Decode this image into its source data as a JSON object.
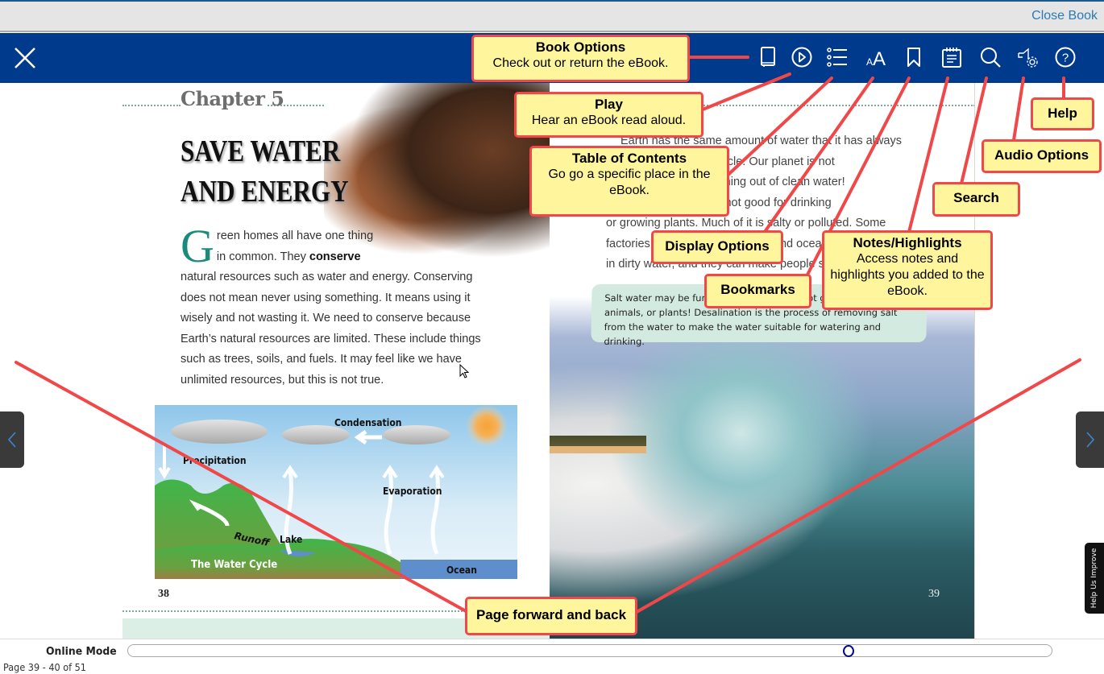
{
  "topbar": {
    "close_book_label": "Close Book"
  },
  "toolbar": {
    "close_icon": "close-icon",
    "tools": [
      {
        "name": "book-options",
        "icon": "book-icon"
      },
      {
        "name": "play",
        "icon": "play-icon"
      },
      {
        "name": "table-of-contents",
        "icon": "list-icon"
      },
      {
        "name": "display-options",
        "icon": "font-size-icon"
      },
      {
        "name": "bookmarks",
        "icon": "bookmark-icon"
      },
      {
        "name": "notes-highlights",
        "icon": "notepad-icon"
      },
      {
        "name": "search",
        "icon": "search-icon"
      },
      {
        "name": "audio-options",
        "icon": "audio-settings-icon"
      },
      {
        "name": "help",
        "icon": "help-icon"
      }
    ]
  },
  "book": {
    "left_page": {
      "chapter": "Chapter 5",
      "title_line1": "SAVE WATER",
      "title_line2": "AND ENERGY",
      "dropcap": "G",
      "para_line1": "reen homes all have one thing",
      "para_line2_pre": "in common. They ",
      "para_line2_bold": "conserve",
      "para_rest": "natural resources such as water and energy. Conserving does not mean never using something. It means using it wisely and not wasting it. We need to conserve because Earth’s natural resources are limited. These include things such as trees, soils, and fuels. It may feel like we have unlimited resources, but this is not true.",
      "diagram": {
        "title": "The Water Cycle",
        "labels": {
          "condensation": "Condensation",
          "precipitation": "Precipitation",
          "evaporation": "Evaporation",
          "runoff": "Runoff",
          "lake": "Lake",
          "ocean": "Ocean"
        }
      },
      "page_number": "38"
    },
    "right_page": {
      "text_lines": [
        "Earth has the same amount of water that it has always",
        "had due to the water cycle. Our planet is not",
        "growing, so we are running out of clean water!",
        "Most water we have is not good for drinking",
        "or growing plants. Much of it is salty or polluted. Some",
        "factories dump waste into rivers and oceans. Animals live",
        "in dirty water, and they can make people sick."
      ],
      "callout": "Salt water may be fun to swim in, but it is not good for people, animals, or plants! Desalination is the process of removing salt from the water to make the water suitable for watering and drinking.",
      "page_number": "39"
    }
  },
  "navigation": {
    "prev_icon": "chevron-left-icon",
    "next_icon": "chevron-right-icon",
    "help_improve_label": "Help Us Improve"
  },
  "footer": {
    "mode_label": "Online Mode",
    "page_count": "Page 39 - 40 of 51",
    "progress_fraction": 0.78
  },
  "annotations": {
    "book_options": {
      "title": "Book Options",
      "desc": "Check out or return the eBook."
    },
    "play": {
      "title": "Play",
      "desc": "Hear an eBook read aloud."
    },
    "toc": {
      "title": "Table of Contents",
      "desc": "Go go a specific place in the eBook."
    },
    "display": {
      "title": "Display Options",
      "desc": ""
    },
    "bookmarks": {
      "title": "Bookmarks",
      "desc": ""
    },
    "notes": {
      "title": "Notes/Highlights",
      "desc": "Access notes and highlights you added to the eBook."
    },
    "search": {
      "title": "Search",
      "desc": ""
    },
    "audio": {
      "title": "Audio Options",
      "desc": ""
    },
    "help": {
      "title": "Help",
      "desc": ""
    },
    "page_nav": {
      "title": "Page forward and back",
      "desc": ""
    }
  },
  "colors": {
    "toolbar_bg": "#003a8c",
    "annotation_fill": "#fff59d",
    "annotation_border": "#f04848",
    "link": "#2a7ab8",
    "slider_thumb": "#000a8a"
  }
}
